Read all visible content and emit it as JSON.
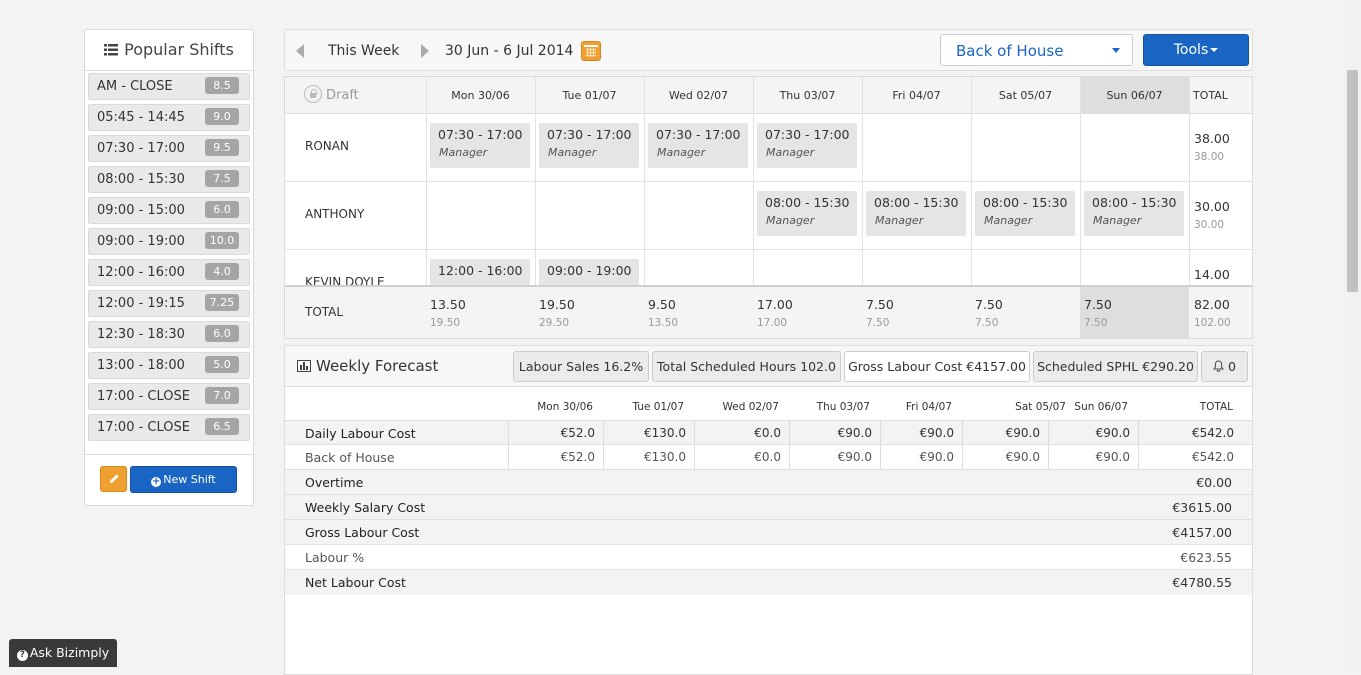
{
  "sidebar": {
    "title": "Popular Shifts",
    "shifts": [
      {
        "label": "AM - CLOSE",
        "hours": "8.5"
      },
      {
        "label": "05:45 - 14:45",
        "hours": "9.0"
      },
      {
        "label": "07:30 - 17:00",
        "hours": "9.5"
      },
      {
        "label": "08:00 - 15:30",
        "hours": "7.5"
      },
      {
        "label": "09:00 - 15:00",
        "hours": "6.0"
      },
      {
        "label": "09:00 - 19:00",
        "hours": "10.0"
      },
      {
        "label": "12:00 - 16:00",
        "hours": "4.0"
      },
      {
        "label": "12:00 - 19:15",
        "hours": "7.25"
      },
      {
        "label": "12:30 - 18:30",
        "hours": "6.0"
      },
      {
        "label": "13:00 - 18:00",
        "hours": "5.0"
      },
      {
        "label": "17:00 - CLOSE",
        "hours": "7.0"
      },
      {
        "label": "17:00 - CLOSE",
        "hours": "6.5"
      }
    ],
    "new_shift_label": "New Shift"
  },
  "toolbar": {
    "this_week": "This Week",
    "date_range": "30 Jun - 6 Jul 2014",
    "department": "Back of House",
    "tools_label": "Tools"
  },
  "schedule": {
    "draft_label": "Draft",
    "days": [
      "Mon 30/06",
      "Tue 01/07",
      "Wed 02/07",
      "Thu 03/07",
      "Fri 04/07",
      "Sat 05/07",
      "Sun 06/07"
    ],
    "total_label": "TOTAL",
    "employees": [
      {
        "name": "RONAN",
        "total": "38.00",
        "total_sub": "38.00",
        "shifts": [
          {
            "time": "07:30 - 17:00",
            "role": "Manager"
          },
          {
            "time": "07:30 - 17:00",
            "role": "Manager"
          },
          {
            "time": "07:30 - 17:00",
            "role": "Manager"
          },
          {
            "time": "07:30 - 17:00",
            "role": "Manager"
          }
        ]
      },
      {
        "name": "ANTHONY",
        "total": "30.00",
        "total_sub": "30.00",
        "shifts": [
          {
            "time": "08:00 - 15:30",
            "role": "Manager"
          },
          {
            "time": "08:00 - 15:30",
            "role": "Manager"
          },
          {
            "time": "08:00 - 15:30",
            "role": "Manager"
          },
          {
            "time": "08:00 - 15:30",
            "role": "Manager"
          }
        ]
      },
      {
        "name": "KEVIN DOYLE",
        "total": "14.00",
        "shifts": [
          {
            "time": "12:00 - 16:00"
          },
          {
            "time": "09:00 - 19:00"
          }
        ]
      }
    ],
    "totals_row": {
      "label": "TOTAL",
      "values": [
        {
          "main": "13.50",
          "sub": "19.50"
        },
        {
          "main": "19.50",
          "sub": "29.50"
        },
        {
          "main": "9.50",
          "sub": "13.50"
        },
        {
          "main": "17.00",
          "sub": "17.00"
        },
        {
          "main": "7.50",
          "sub": "7.50"
        },
        {
          "main": "7.50",
          "sub": "7.50"
        },
        {
          "main": "7.50",
          "sub": "7.50"
        },
        {
          "main": "82.00",
          "sub": "102.00"
        }
      ]
    }
  },
  "forecast": {
    "title": "Weekly Forecast",
    "tabs": [
      {
        "label": "Labour Sales 16.2%"
      },
      {
        "label": "Total Scheduled Hours 102.0"
      },
      {
        "label": "Gross Labour Cost €4157.00"
      },
      {
        "label": "Scheduled SPHL €290.20"
      },
      {
        "label": "0"
      }
    ],
    "columns": [
      "Mon 30/06",
      "Tue 01/07",
      "Wed 02/07",
      "Thu 03/07",
      "Fri 04/07",
      "Sat 05/07",
      "Sun 06/07",
      "TOTAL"
    ],
    "daily_rows": [
      {
        "label": "Daily Labour Cost",
        "values": [
          "€52.0",
          "€130.0",
          "€0.0",
          "€90.0",
          "€90.0",
          "€90.0",
          "€90.0",
          "€542.0"
        ]
      },
      {
        "label": "Back of House",
        "values": [
          "€52.0",
          "€130.0",
          "€0.0",
          "€90.0",
          "€90.0",
          "€90.0",
          "€90.0",
          "€542.0"
        ]
      }
    ],
    "summary_rows": [
      {
        "label": "Overtime",
        "value": "€0.00"
      },
      {
        "label": "Weekly Salary Cost",
        "value": "€3615.00"
      },
      {
        "label": "Gross Labour Cost",
        "value": "€4157.00"
      },
      {
        "label": "Labour %",
        "value": "€623.55"
      },
      {
        "label": "Net Labour Cost",
        "value": "€4780.55"
      }
    ]
  },
  "help": {
    "label": "Ask Bizimply"
  },
  "colors": {
    "primary": "#1a64c4",
    "accent": "#f0a030",
    "shift_block": "#e5e5e5"
  }
}
